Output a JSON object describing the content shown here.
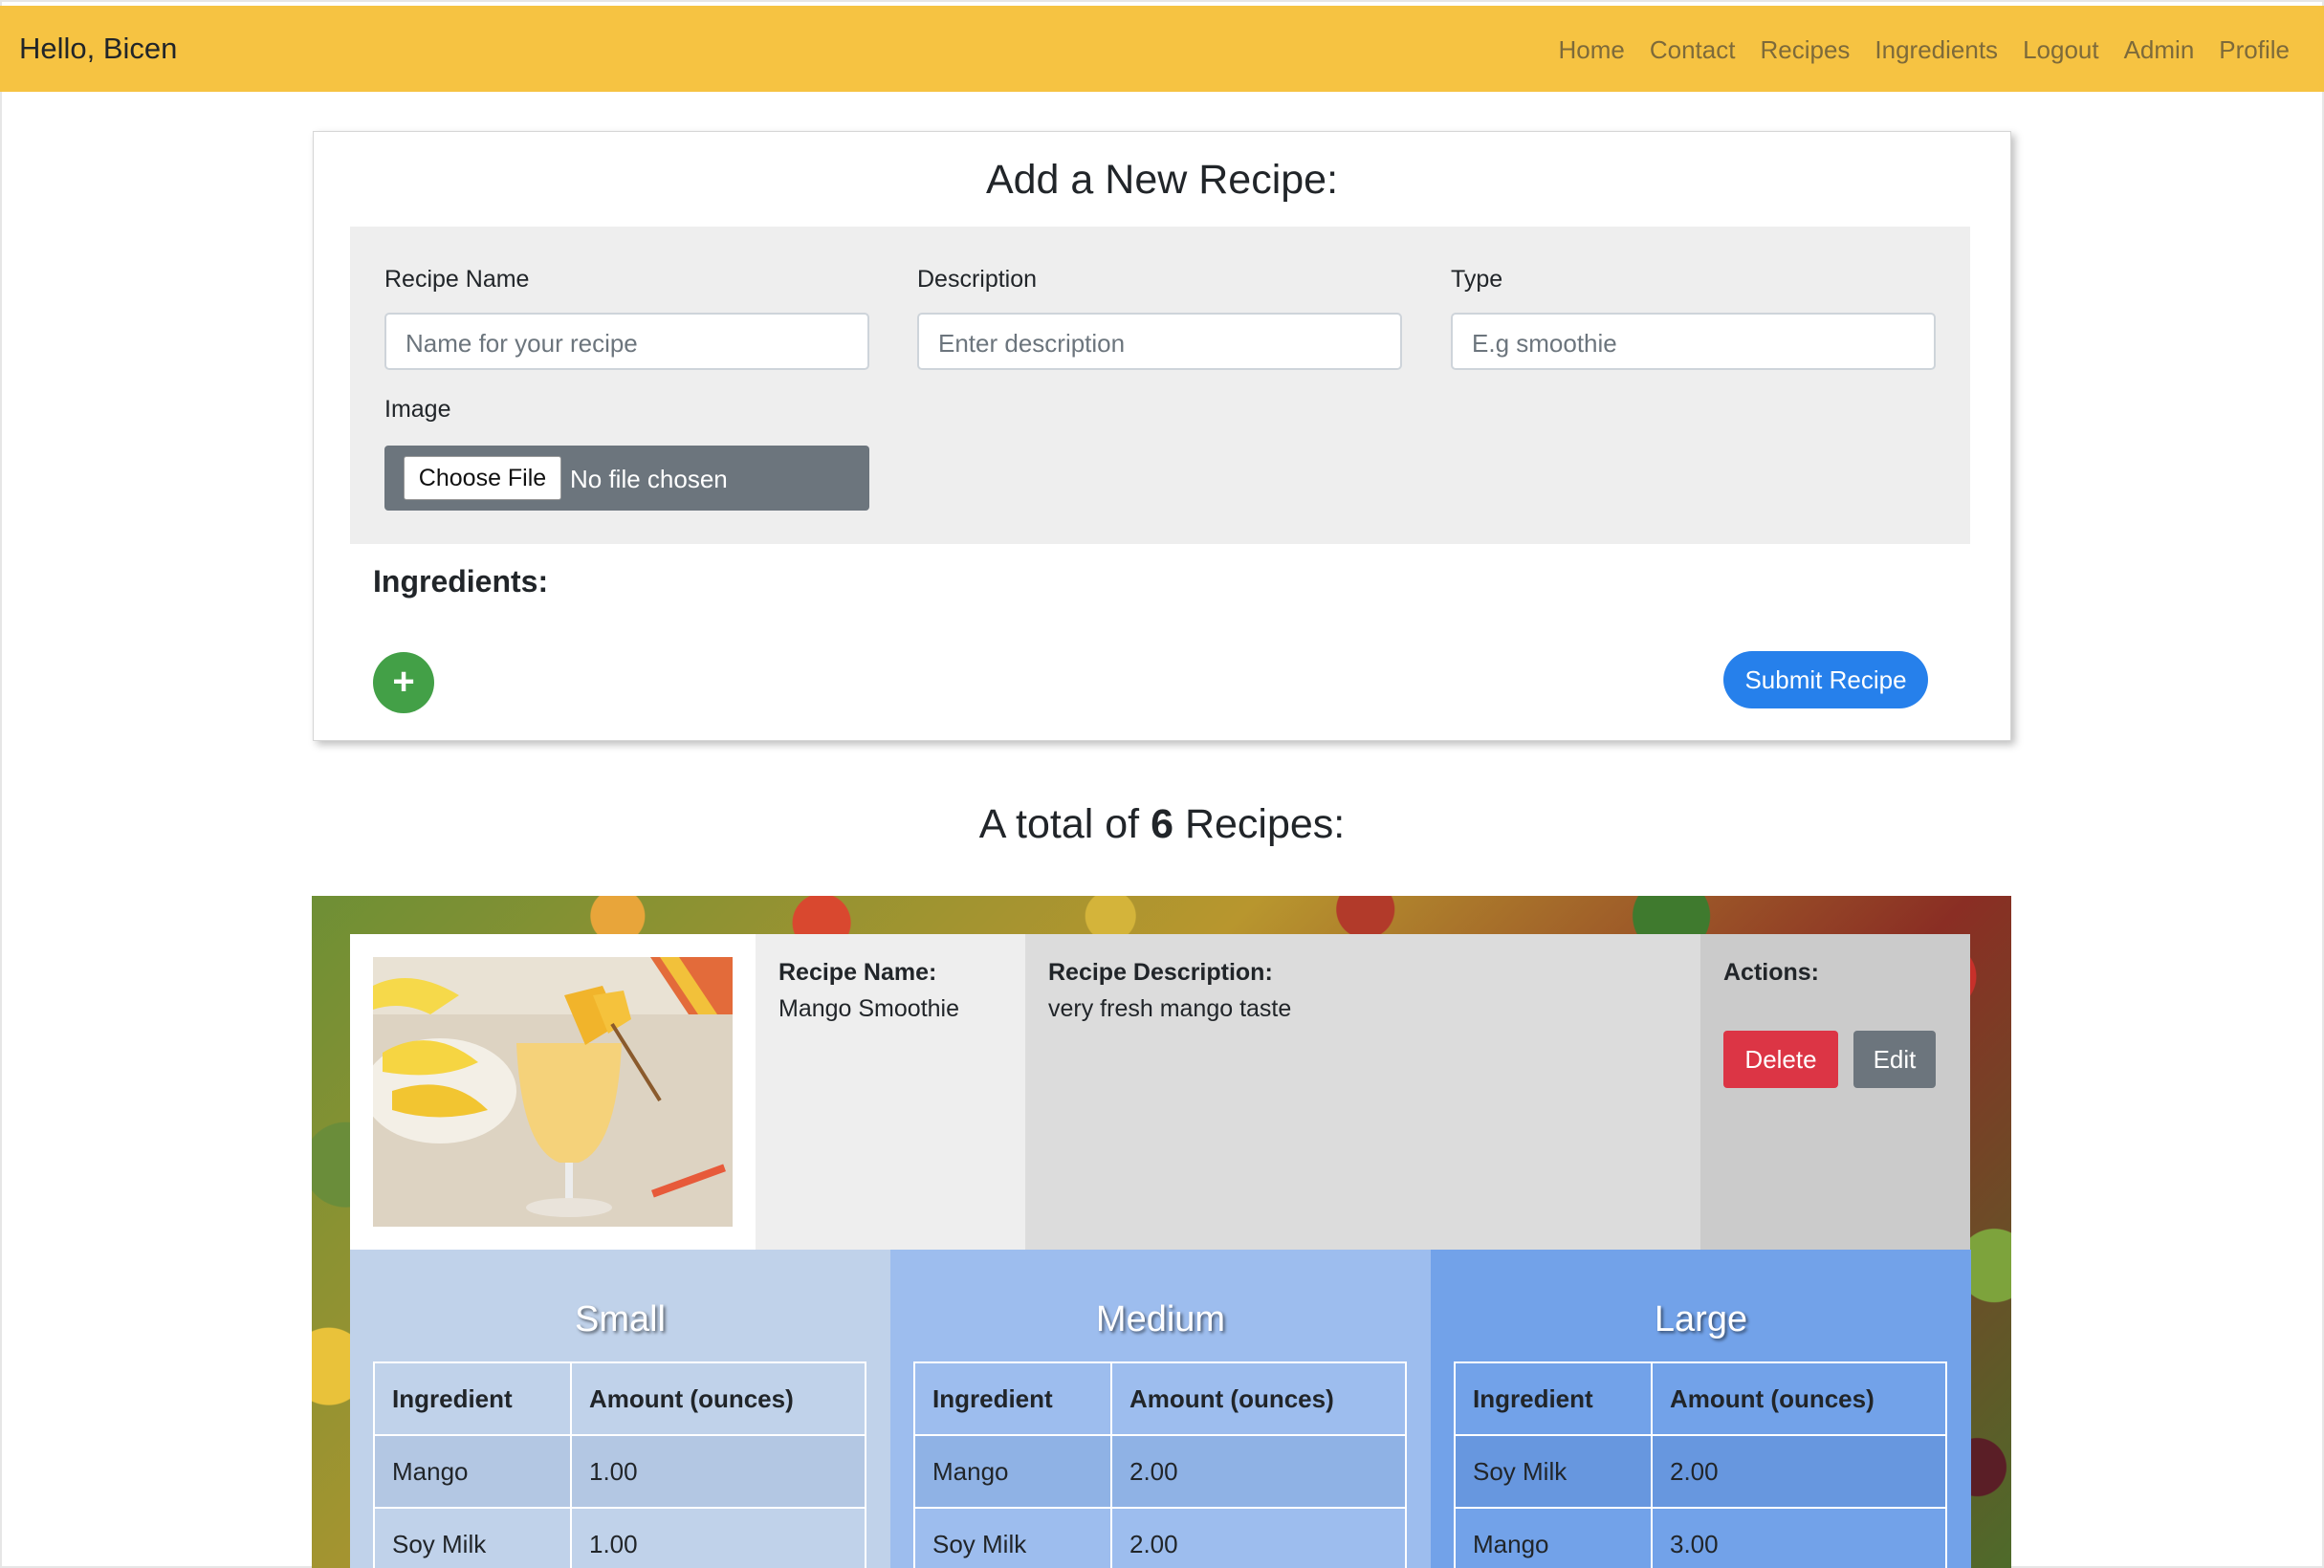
{
  "navbar": {
    "greeting": "Hello, Bicen",
    "links": [
      "Home",
      "Contact",
      "Recipes",
      "Ingredients",
      "Logout",
      "Admin",
      "Profile"
    ]
  },
  "form": {
    "title": "Add a New Recipe:",
    "recipe_name_label": "Recipe Name",
    "recipe_name_placeholder": "Name for your recipe",
    "description_label": "Description",
    "description_placeholder": "Enter description",
    "type_label": "Type",
    "type_placeholder": "E.g smoothie",
    "image_label": "Image",
    "choose_file_label": "Choose File",
    "no_file_text": "No file chosen",
    "ingredients_heading": "Ingredients:",
    "add_icon": "+",
    "submit_label": "Submit Recipe"
  },
  "total": {
    "prefix": "A total of",
    "count": "6",
    "suffix": "Recipes:"
  },
  "recipe": {
    "name_title": "Recipe Name:",
    "name": "Mango Smoothie",
    "description_title": "Recipe Description:",
    "description": "very fresh mango taste",
    "actions_title": "Actions:",
    "delete_label": "Delete",
    "edit_label": "Edit",
    "sizes": [
      {
        "title": "Small",
        "headers": [
          "Ingredient",
          "Amount (ounces)"
        ],
        "rows": [
          [
            "Mango",
            "1.00"
          ],
          [
            "Soy Milk",
            "1.00"
          ]
        ]
      },
      {
        "title": "Medium",
        "headers": [
          "Ingredient",
          "Amount (ounces)"
        ],
        "rows": [
          [
            "Mango",
            "2.00"
          ],
          [
            "Soy Milk",
            "2.00"
          ]
        ]
      },
      {
        "title": "Large",
        "headers": [
          "Ingredient",
          "Amount (ounces)"
        ],
        "rows": [
          [
            "Soy Milk",
            "2.00"
          ],
          [
            "Mango",
            "3.00"
          ]
        ]
      }
    ]
  },
  "colors": {
    "navbar": "#f6c342",
    "submit": "#2680eb",
    "add": "#43a047",
    "delete": "#dc3545",
    "edit": "#6c757d",
    "small_col": "#c0d2ea",
    "medium_col": "#9dbdee",
    "large_col": "#72a2e9"
  }
}
